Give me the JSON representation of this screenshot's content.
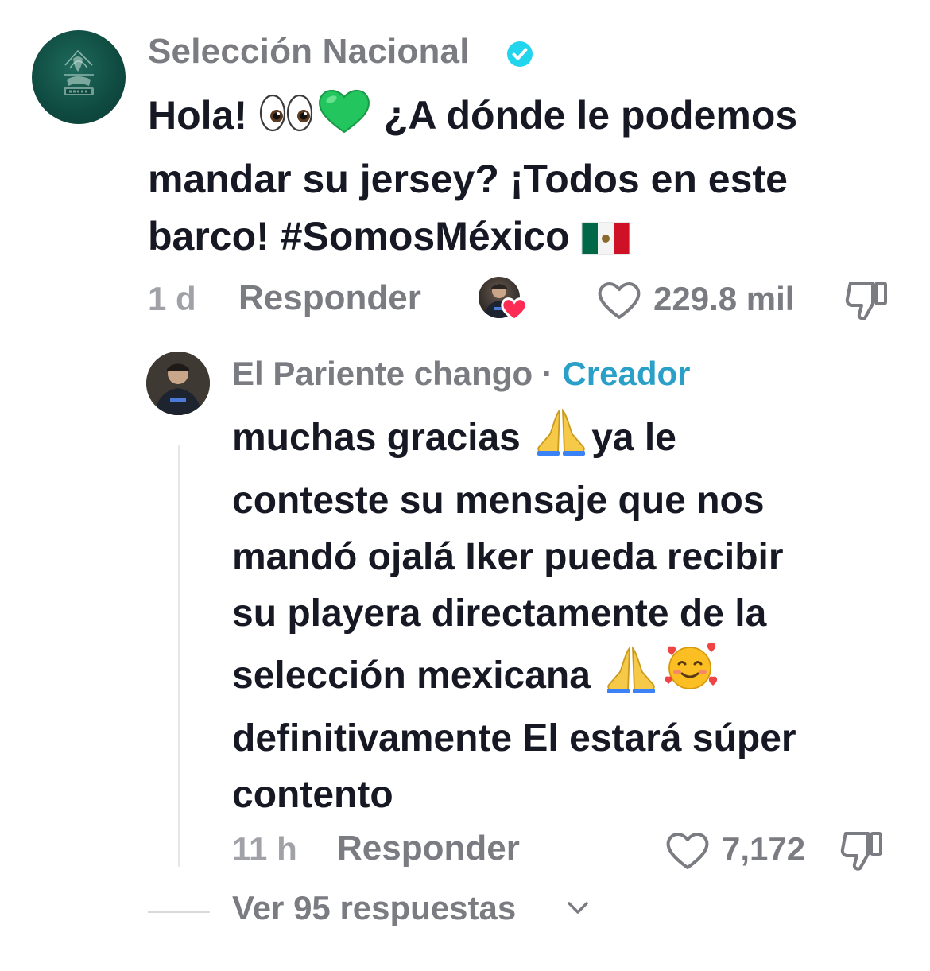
{
  "comment": {
    "author": "Selección Nacional",
    "verified": true,
    "text_lines": [
      "Hola! ",
      "mandar su jersey? ¡Todos en este",
      "barco! #SomosMéxico "
    ],
    "text_line1_tail": " ¿A dónde le podemos",
    "emojis_line1": [
      "👀",
      "💚"
    ],
    "emoji_line3": "🇲🇽",
    "time": "1 d",
    "reply_label": "Responder",
    "likes": "229.8 mil",
    "liked_by_creator": true
  },
  "reply": {
    "author": "El Pariente chango",
    "separator": " · ",
    "badge": "Creador",
    "text_lines": [
      "muchas gracias ",
      "conteste su mensaje que nos",
      "mandó ojalá Iker pueda recibir",
      "su playera directamente de la",
      "selección mexicana ",
      "definitivamente El estará súper",
      "contento"
    ],
    "line1_tail": "ya le",
    "emoji_pray": "🙏",
    "emoji_smile_hearts": "🥰",
    "time": "11 h",
    "reply_label": "Responder",
    "likes": "7,172"
  },
  "view_replies": {
    "label": "Ver 95 respuestas"
  },
  "colors": {
    "text_primary": "#161823",
    "text_secondary": "#7a7c82",
    "text_muted": "#a0a2a8",
    "creator_badge": "#2aa0c8",
    "verified_badge": "#20d5ec",
    "like_heart": "#fe2c55"
  },
  "icons": {
    "verified": "verified-check-icon",
    "like": "heart-outline-icon",
    "dislike": "thumbs-down-outline-icon",
    "expand": "chevron-down-icon"
  }
}
